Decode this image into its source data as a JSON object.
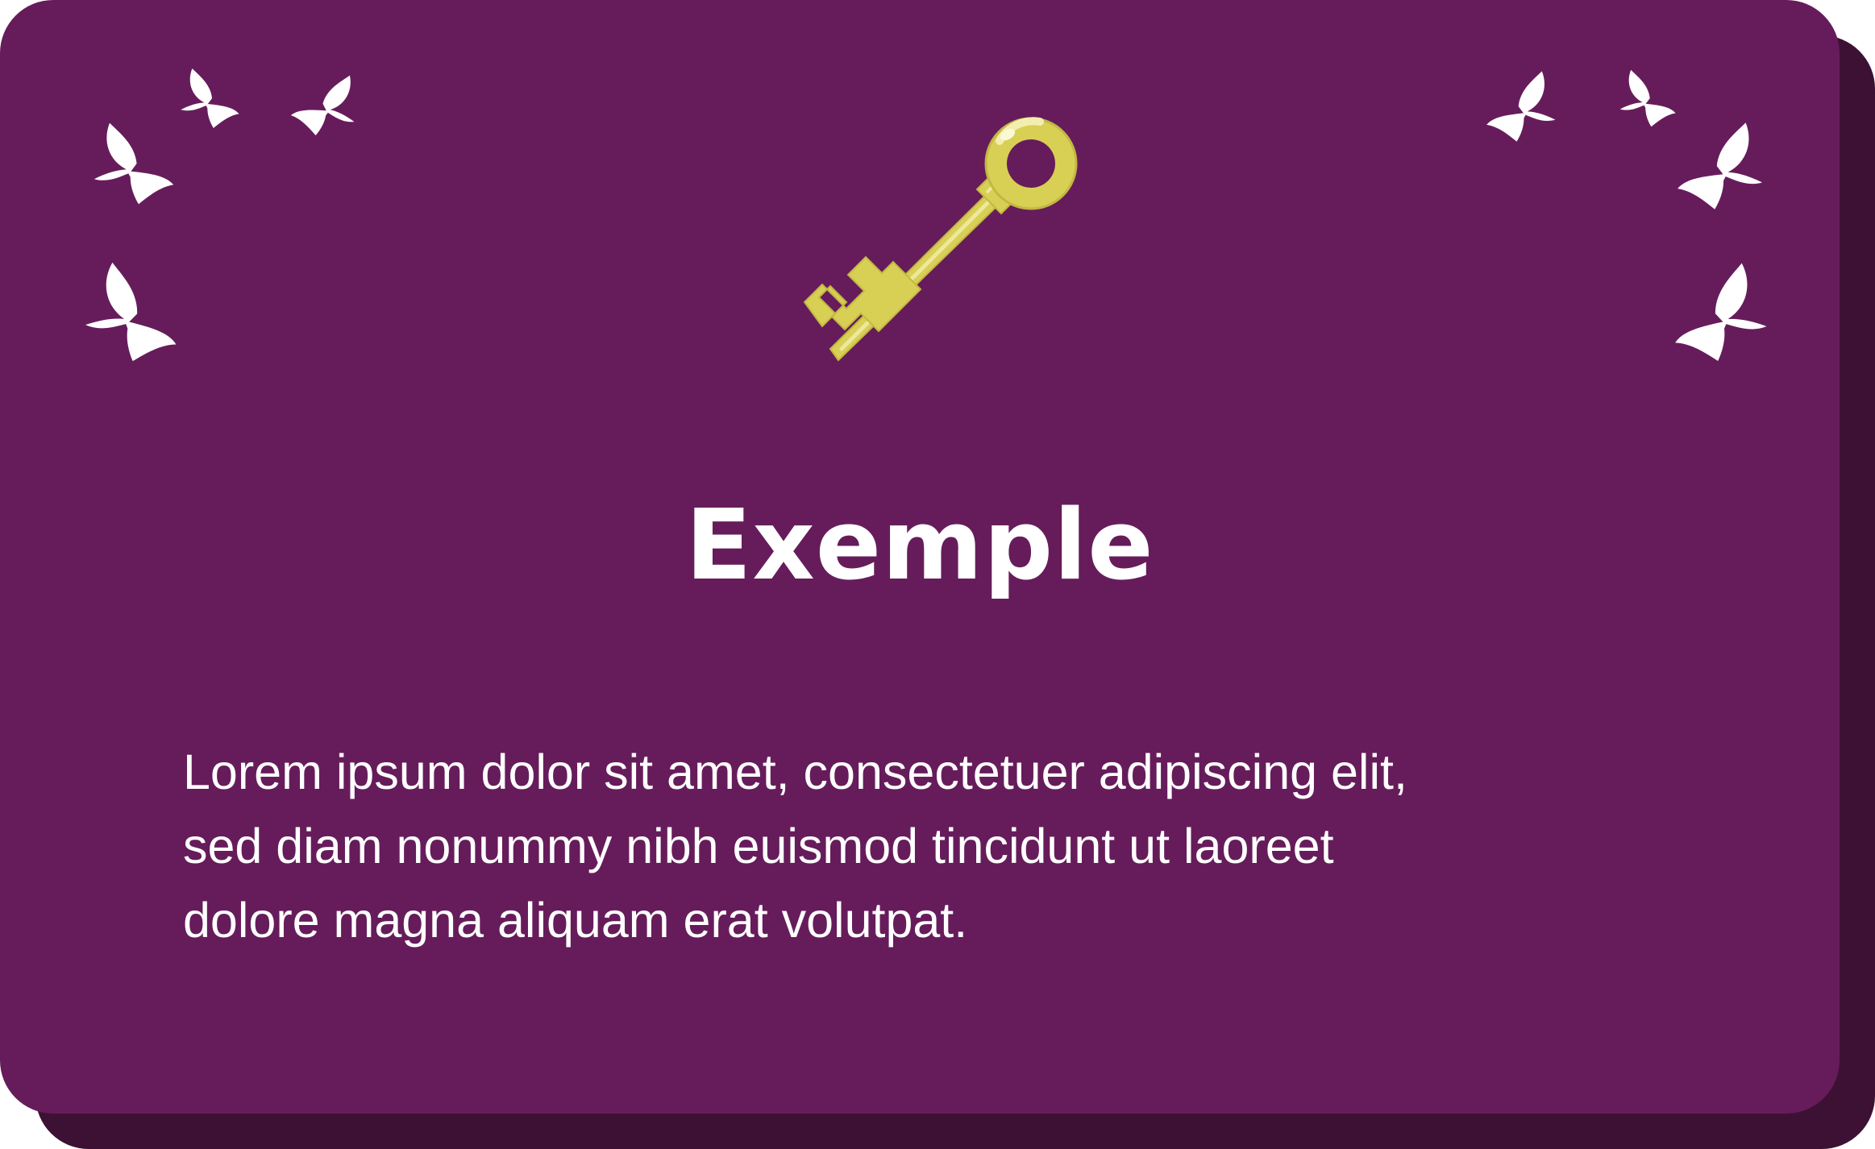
{
  "card": {
    "title": "Exemple",
    "body_lines": [
      "Lorem ipsum dolor sit amet, consectetuer adipiscing elit,",
      "sed diam nonummy nibh euismod tincidunt ut laoreet",
      "dolore magna aliquam erat volutpat."
    ]
  },
  "icons": {
    "central": "key-icon",
    "decorations": "butterfly-icon"
  },
  "colors": {
    "card_background": "#661c5b",
    "card_shadow": "#3d1134",
    "key_gold": "#d8cf55",
    "text": "#ffffff"
  }
}
